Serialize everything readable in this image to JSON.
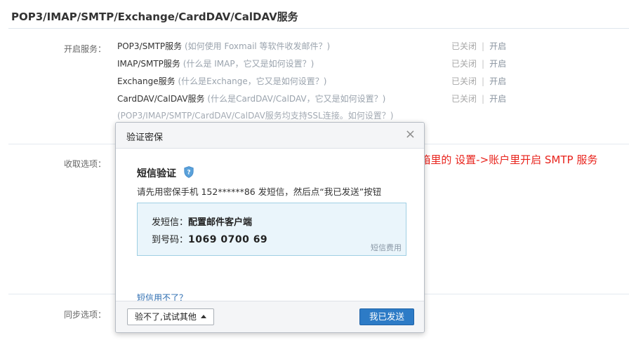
{
  "section": {
    "title": "POP3/IMAP/SMTP/Exchange/CardDAV/CalDAV服务"
  },
  "labels": {
    "enable": "开启服务：",
    "receive": "收取选项：",
    "sync": "同步选项："
  },
  "services": [
    {
      "name": "POP3/SMTP服务",
      "open": "(",
      "help": "如何使用 Foxmail 等软件收发邮件？",
      "close": ")",
      "status_off": "已关闭",
      "sep": "|",
      "status_on": "开启"
    },
    {
      "name": "IMAP/SMTP服务",
      "open": "(",
      "help": "什么是 IMAP，它又是如何设置？",
      "close": ")",
      "status_off": "已关闭",
      "sep": "|",
      "status_on": "开启"
    },
    {
      "name": "Exchange服务",
      "open": "(",
      "help": "什么是Exchange，它又是如何设置？",
      "close": ")",
      "status_off": "已关闭",
      "sep": "|",
      "status_on": "开启"
    },
    {
      "name": "CardDAV/CalDAV服务",
      "open": "(",
      "help": "什么是CardDAV/CalDAV，它又是如何设置？",
      "close": ")",
      "status_off": "已关闭",
      "sep": "|",
      "status_on": "开启"
    }
  ],
  "ssl_note": "(POP3/IMAP/SMTP/CardDAV/CalDAV服务均支持SSL连接。如何设置？)",
  "annotation": "QQ 邮箱里的 设置->账户里开启 SMTP 服务",
  "modal": {
    "title": "验证密保",
    "close_icon": "×",
    "verify_title": "短信验证",
    "instruction": "请先用密保手机 152******86 发短信，然后点“我已发送”按钮",
    "sms_label": "发短信：",
    "sms_content": "配置邮件客户端",
    "to_label": "到号码：",
    "to_number": "1069 0700 69",
    "fee": "短信费用",
    "cant_use": "短信用不了？",
    "alt_button": "验不了,试试其他",
    "sent_button": "我已发送"
  },
  "colors": {
    "accent_blue": "#2d7bc6",
    "annotation_red": "#e8231c",
    "sms_box_bg": "#eaf5fb"
  }
}
